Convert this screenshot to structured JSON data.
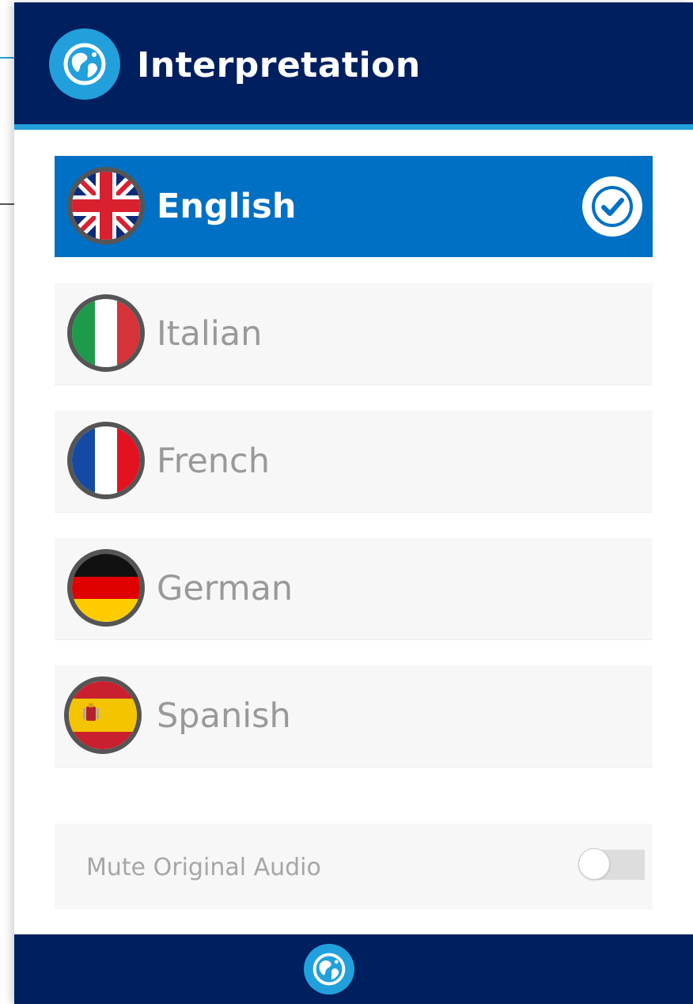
{
  "header": {
    "title": "Interpretation",
    "logo_icon": "globe-icon"
  },
  "languages": [
    {
      "label": "English",
      "flag": "uk-flag-icon",
      "selected": true
    },
    {
      "label": "Italian",
      "flag": "italy-flag-icon",
      "selected": false
    },
    {
      "label": "French",
      "flag": "france-flag-icon",
      "selected": false
    },
    {
      "label": "German",
      "flag": "germany-flag-icon",
      "selected": false
    },
    {
      "label": "Spanish",
      "flag": "spain-flag-icon",
      "selected": false
    }
  ],
  "mute": {
    "label": "Mute Original Audio",
    "enabled": false
  },
  "footer": {
    "icon": "globe-icon"
  },
  "colors": {
    "navy": "#001f5f",
    "accent": "#21a0dc",
    "selected": "#0070c4",
    "row_bg": "#f7f7f7",
    "text_muted": "#999999"
  }
}
